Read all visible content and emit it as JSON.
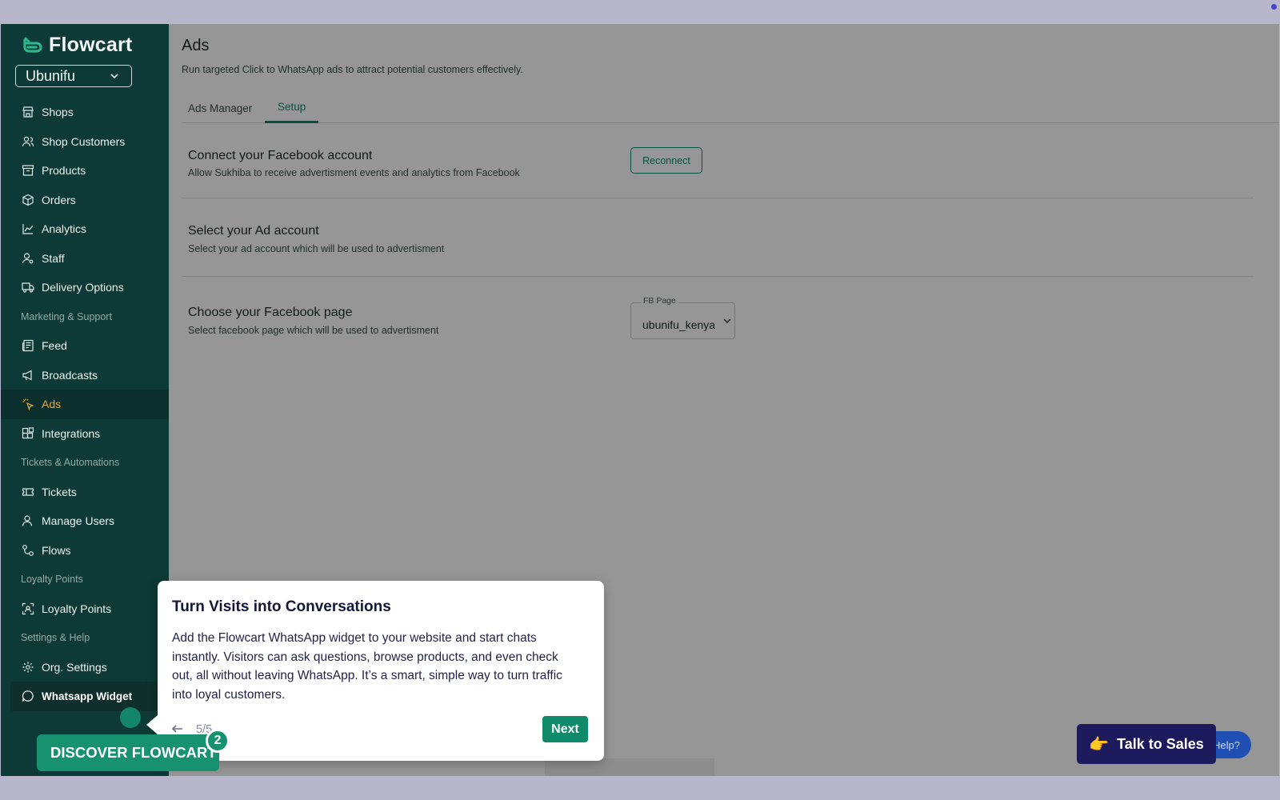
{
  "brand": {
    "name": "Flowcart",
    "org": "Ubunifu"
  },
  "sidebar": {
    "items": [
      {
        "label": "Shops",
        "icon": "store-icon"
      },
      {
        "label": "Shop Customers",
        "icon": "users-icon"
      },
      {
        "label": "Products",
        "icon": "archive-icon"
      },
      {
        "label": "Orders",
        "icon": "package-icon"
      },
      {
        "label": "Analytics",
        "icon": "chart-icon"
      },
      {
        "label": "Staff",
        "icon": "user-cog-icon"
      },
      {
        "label": "Delivery Options",
        "icon": "truck-icon"
      }
    ],
    "section_marketing": "Marketing & Support",
    "marketing_items": [
      {
        "label": "Feed",
        "icon": "newspaper-icon"
      },
      {
        "label": "Broadcasts",
        "icon": "megaphone-icon"
      },
      {
        "label": "Ads",
        "icon": "sparkle-click-icon"
      },
      {
        "label": "Integrations",
        "icon": "blocks-icon"
      }
    ],
    "section_tickets": "Tickets & Automations",
    "ticket_items": [
      {
        "label": "Tickets",
        "icon": "ticket-icon"
      },
      {
        "label": "Manage Users",
        "icon": "user-icon"
      },
      {
        "label": "Flows",
        "icon": "flow-icon"
      }
    ],
    "section_loyalty": "Loyalty Points",
    "loyalty_items": [
      {
        "label": "Loyalty Points",
        "icon": "scan-icon"
      }
    ],
    "section_settings": "Settings & Help",
    "settings_items": [
      {
        "label": "Org. Settings",
        "icon": "gear-icon"
      },
      {
        "label": "Whatsapp Widget",
        "icon": "chat-icon"
      }
    ]
  },
  "page": {
    "title": "Ads",
    "subtitle": "Run targeted Click to WhatsApp ads to attract potential customers effectively.",
    "tabs": [
      {
        "label": "Ads Manager"
      },
      {
        "label": "Setup"
      }
    ],
    "rows": [
      {
        "title": "Connect your Facebook account",
        "desc": "Allow Sukhiba to receive advertisment events and analytics from Facebook",
        "button": "Reconnect"
      },
      {
        "title": "Select your Ad account",
        "desc": "Select your ad account which will be used to advertisment"
      },
      {
        "title": "Choose your Facebook page",
        "desc": "Select facebook page which will be used to advertisment",
        "select_label": "FB Page",
        "select_value": "ubunifu_kenya"
      }
    ]
  },
  "tour": {
    "title": "Turn Visits into Conversations",
    "body": "Add the Flowcart WhatsApp widget to your website and start chats instantly. Visitors can ask questions, browse products, and even check out, all without leaving WhatsApp. It’s a smart, simple way to turn traffic into loyal customers.",
    "step": "5/5",
    "next": "Next"
  },
  "discover": {
    "label": "DISCOVER FLOWCART",
    "badge": "2"
  },
  "talk_sales": {
    "emoji": "👉",
    "label": "Talk to Sales"
  },
  "help": {
    "label": "Help?"
  },
  "colors": {
    "sidebar": "#0d3a36",
    "accent": "#0f8a6a",
    "active_nav": "#e6a93b",
    "sales_button": "#1d1a5e"
  }
}
